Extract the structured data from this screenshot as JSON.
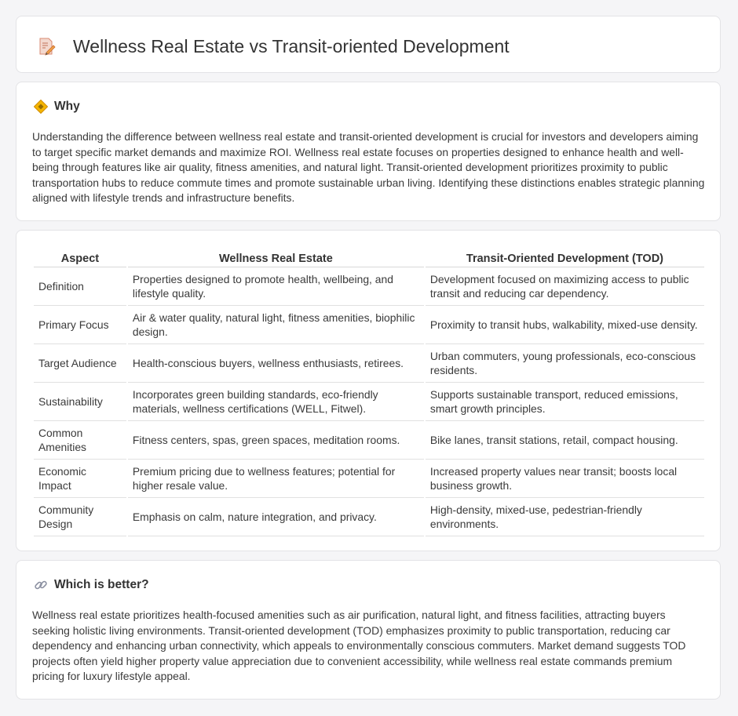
{
  "header": {
    "title": "Wellness Real Estate vs Transit-oriented Development",
    "icon": "document-pencil-icon"
  },
  "why": {
    "heading": "Why",
    "icon": "diamond-warning-icon",
    "text": "Understanding the difference between wellness real estate and transit-oriented development is crucial for investors and developers aiming to target specific market demands and maximize ROI. Wellness real estate focuses on properties designed to enhance health and well-being through features like air quality, fitness amenities, and natural light. Transit-oriented development prioritizes proximity to public transportation hubs to reduce commute times and promote sustainable urban living. Identifying these distinctions enables strategic planning aligned with lifestyle trends and infrastructure benefits."
  },
  "table": {
    "headers": [
      "Aspect",
      "Wellness Real Estate",
      "Transit-Oriented Development (TOD)"
    ],
    "rows": [
      [
        "Definition",
        "Properties designed to promote health, wellbeing, and lifestyle quality.",
        "Development focused on maximizing access to public transit and reducing car dependency."
      ],
      [
        "Primary Focus",
        "Air & water quality, natural light, fitness amenities, biophilic design.",
        "Proximity to transit hubs, walkability, mixed-use density."
      ],
      [
        "Target Audience",
        "Health-conscious buyers, wellness enthusiasts, retirees.",
        "Urban commuters, young professionals, eco-conscious residents."
      ],
      [
        "Sustainability",
        "Incorporates green building standards, eco-friendly materials, wellness certifications (WELL, Fitwel).",
        "Supports sustainable transport, reduced emissions, smart growth principles."
      ],
      [
        "Common Amenities",
        "Fitness centers, spas, green spaces, meditation rooms.",
        "Bike lanes, transit stations, retail, compact housing."
      ],
      [
        "Economic Impact",
        "Premium pricing due to wellness features; potential for higher resale value.",
        "Increased property values near transit; boosts local business growth."
      ],
      [
        "Community Design",
        "Emphasis on calm, nature integration, and privacy.",
        "High-density, mixed-use, pedestrian-friendly environments."
      ]
    ]
  },
  "better": {
    "heading": "Which is better?",
    "icon": "link-icon",
    "text": "Wellness real estate prioritizes health-focused amenities such as air purification, natural light, and fitness facilities, attracting buyers seeking holistic living environments. Transit-oriented development (TOD) emphasizes proximity to public transportation, reducing car dependency and enhancing urban connectivity, which appeals to environmentally conscious commuters. Market demand suggests TOD projects often yield higher property value appreciation due to convenient accessibility, while wellness real estate commands premium pricing for luxury lifestyle appeal."
  }
}
